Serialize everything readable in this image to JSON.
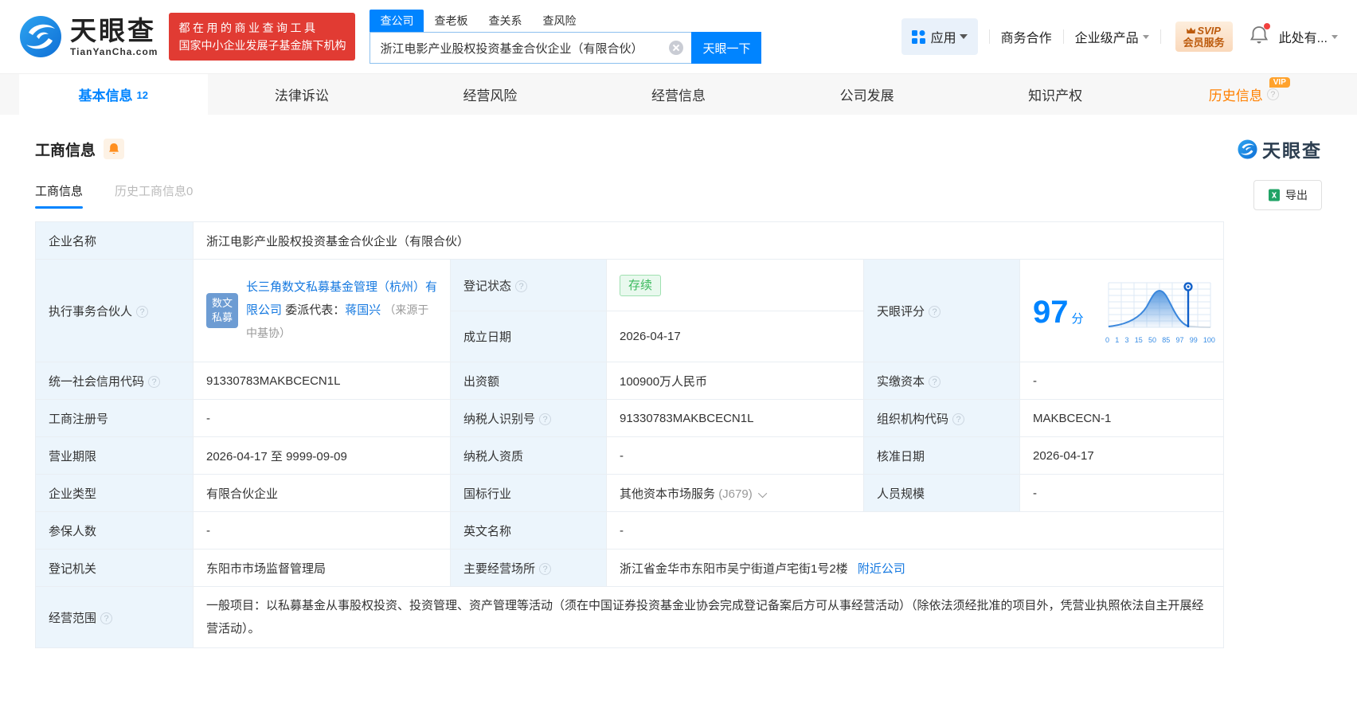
{
  "header": {
    "brand": "天眼查",
    "brand_domain": "TianYanCha.com",
    "slogan_line1": "都在用的商业查询工具",
    "slogan_line2": "国家中小企业发展子基金旗下机构",
    "search": {
      "tabs": [
        {
          "label": "查公司",
          "active": true
        },
        {
          "label": "查老板",
          "active": false
        },
        {
          "label": "查关系",
          "active": false
        },
        {
          "label": "查风险",
          "active": false
        }
      ],
      "value": "浙江电影产业股权投资基金合伙企业（有限合伙）",
      "submit_label": "天眼一下"
    },
    "menu": {
      "apps_label": "应用",
      "cooperation_label": "商务合作",
      "enterprise_label": "企业级产品",
      "svip_line1": "SVIP",
      "svip_line2": "会员服务",
      "user_label": "此处有..."
    }
  },
  "main_tabs": [
    {
      "label": "基本信息",
      "count": "12",
      "active": true
    },
    {
      "label": "法律诉讼"
    },
    {
      "label": "经营风险"
    },
    {
      "label": "经营信息"
    },
    {
      "label": "公司发展"
    },
    {
      "label": "知识产权"
    },
    {
      "label": "历史信息",
      "vip": true,
      "vip_text": "VIP",
      "help": true
    }
  ],
  "section": {
    "title": "工商信息",
    "watermark_brand": "天眼查",
    "subtabs": [
      {
        "label": "工商信息",
        "active": true
      },
      {
        "label": "历史工商信息",
        "count": "0",
        "active": false
      }
    ],
    "export_label": "导出"
  },
  "fields": {
    "company_name": {
      "label": "企业名称",
      "value": "浙江电影产业股权投资基金合伙企业（有限合伙）"
    },
    "partner": {
      "label": "执行事务合伙人",
      "tag_line1": "数文",
      "tag_line2": "私募",
      "company": "长三角数文私募基金管理（杭州）有限公司",
      "rep_label": "委派代表：",
      "rep_name": "蒋国兴",
      "rep_source": "（来源于中基协）"
    },
    "reg_status": {
      "label": "登记状态",
      "value": "存续"
    },
    "est_date": {
      "label": "成立日期",
      "value": "2026-04-17"
    },
    "score": {
      "label": "天眼评分",
      "value": "97",
      "unit": "分"
    },
    "credit_code": {
      "label": "统一社会信用代码",
      "value": "91330783MAKBCECN1L"
    },
    "capital": {
      "label": "出资额",
      "value": "100900万人民币"
    },
    "paid_capital": {
      "label": "实缴资本",
      "value": "-"
    },
    "reg_number": {
      "label": "工商注册号",
      "value": "-"
    },
    "taxpayer_id": {
      "label": "纳税人识别号",
      "value": "91330783MAKBCECN1L"
    },
    "org_code": {
      "label": "组织机构代码",
      "value": "MAKBCECN-1"
    },
    "business_term": {
      "label": "营业期限",
      "value": "2026-04-17 至 9999-09-09"
    },
    "taxpayer_quality": {
      "label": "纳税人资质",
      "value": "-"
    },
    "approval_date": {
      "label": "核准日期",
      "value": "2026-04-17"
    },
    "company_type": {
      "label": "企业类型",
      "value": "有限合伙企业"
    },
    "industry": {
      "label": "国标行业",
      "value": "其他资本市场服务",
      "code": "(J679)"
    },
    "staff_size": {
      "label": "人员规模",
      "value": "-"
    },
    "insured_count": {
      "label": "参保人数",
      "value": "-"
    },
    "english_name": {
      "label": "英文名称",
      "value": "-"
    },
    "reg_authority": {
      "label": "登记机关",
      "value": "东阳市市场监督管理局"
    },
    "business_address": {
      "label": "主要经营场所",
      "value": "浙江省金华市东阳市吴宁街道卢宅街1号2楼",
      "link": "附近公司"
    },
    "business_scope": {
      "label": "经营范围",
      "value": "一般项目：以私募基金从事股权投资、投资管理、资产管理等活动（须在中国证券投资基金业协会完成登记备案后方可从事经营活动）（除依法须经批准的项目外，凭营业执照依法自主开展经营活动）。"
    }
  },
  "score_chart": {
    "type": "area",
    "score": 97,
    "marker_value": 97,
    "x_ticks": [
      "0",
      "1",
      "3",
      "15",
      "50",
      "85",
      "97",
      "99",
      "100"
    ],
    "curve_color": "#3b87dc",
    "marker_color": "#1160c9",
    "description": "天眼评分分布钟形曲线，标记位于97分"
  },
  "colors": {
    "primary_blue": "#0084ff",
    "link_blue": "#1679e0",
    "status_green": "#3bba5d",
    "vip_orange": "#ff8000",
    "badge_red": "#e13b33"
  }
}
